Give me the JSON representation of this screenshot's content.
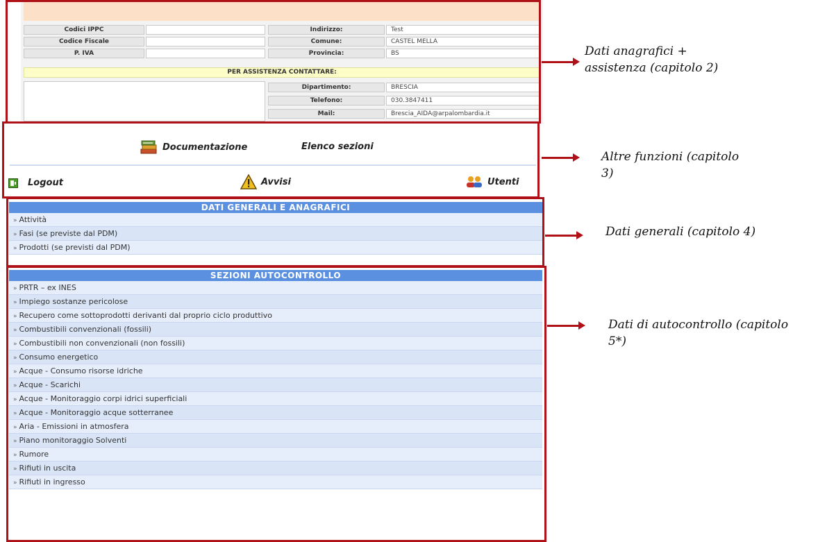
{
  "info": {
    "rows": [
      {
        "l1": "Codici IPPC",
        "v1": "",
        "l2": "Indirizzo:",
        "v2": "Test"
      },
      {
        "l1": "Codice Fiscale",
        "v1": "",
        "l2": "Comune:",
        "v2": "CASTEL MELLA"
      },
      {
        "l1": "P. IVA",
        "v1": "",
        "l2": "Provincia:",
        "v2": "BS"
      }
    ],
    "assistance": "PER ASSISTENZA CONTATTARE:",
    "contacts": [
      {
        "label": "Dipartimento:",
        "value": "BRESCIA"
      },
      {
        "label": "Telefono:",
        "value": "030.3847411"
      },
      {
        "label": "Mail:",
        "value": "Brescia_AIDA@arpalombardia.it"
      }
    ]
  },
  "functions": {
    "documentazione": "Documentazione",
    "elenco": "Elenco sezioni",
    "logout": "Logout",
    "avvisi": "Avvisi",
    "utenti": "Utenti"
  },
  "menus": {
    "general": {
      "title": "DATI GENERALI E ANAGRAFICI",
      "items": [
        "Attività",
        "Fasi (se previste dal PDM)",
        "Prodotti (se previsti dal PDM)"
      ]
    },
    "auto": {
      "title": "SEZIONI AUTOCONTROLLO",
      "items": [
        "PRTR – ex INES",
        "Impiego sostanze pericolose",
        "Recupero come sottoprodotti derivanti dal proprio ciclo produttivo",
        "Combustibili convenzionali (fossili)",
        "Combustibili non convenzionali (non fossili)",
        "Consumo energetico",
        "Acque - Consumo risorse idriche",
        "Acque - Scarichi",
        "Acque - Monitoraggio corpi idrici superficiali",
        "Acque - Monitoraggio acque sotterranee",
        "Aria - Emissioni in atmosfera",
        "Piano monitoraggio Solventi",
        "Rumore",
        "Rifiuti in uscita",
        "Rifiuti in ingresso"
      ]
    }
  },
  "annotations": {
    "a1_l1": "Dati anagrafici +",
    "a1_l2": "assistenza (capitolo 2)",
    "a2_l1": "Altre funzioni (capitolo",
    "a2_l2": "3)",
    "a3": "Dati generali (capitolo 4)",
    "a4_l1": "Dati di autocontrollo (capitolo",
    "a4_l2": "5*)"
  },
  "colors": {
    "frame": "#b01018",
    "menu_header": "#5b8fe0",
    "row_light": "#e6eefb",
    "row_dark": "#d9e5f7"
  }
}
